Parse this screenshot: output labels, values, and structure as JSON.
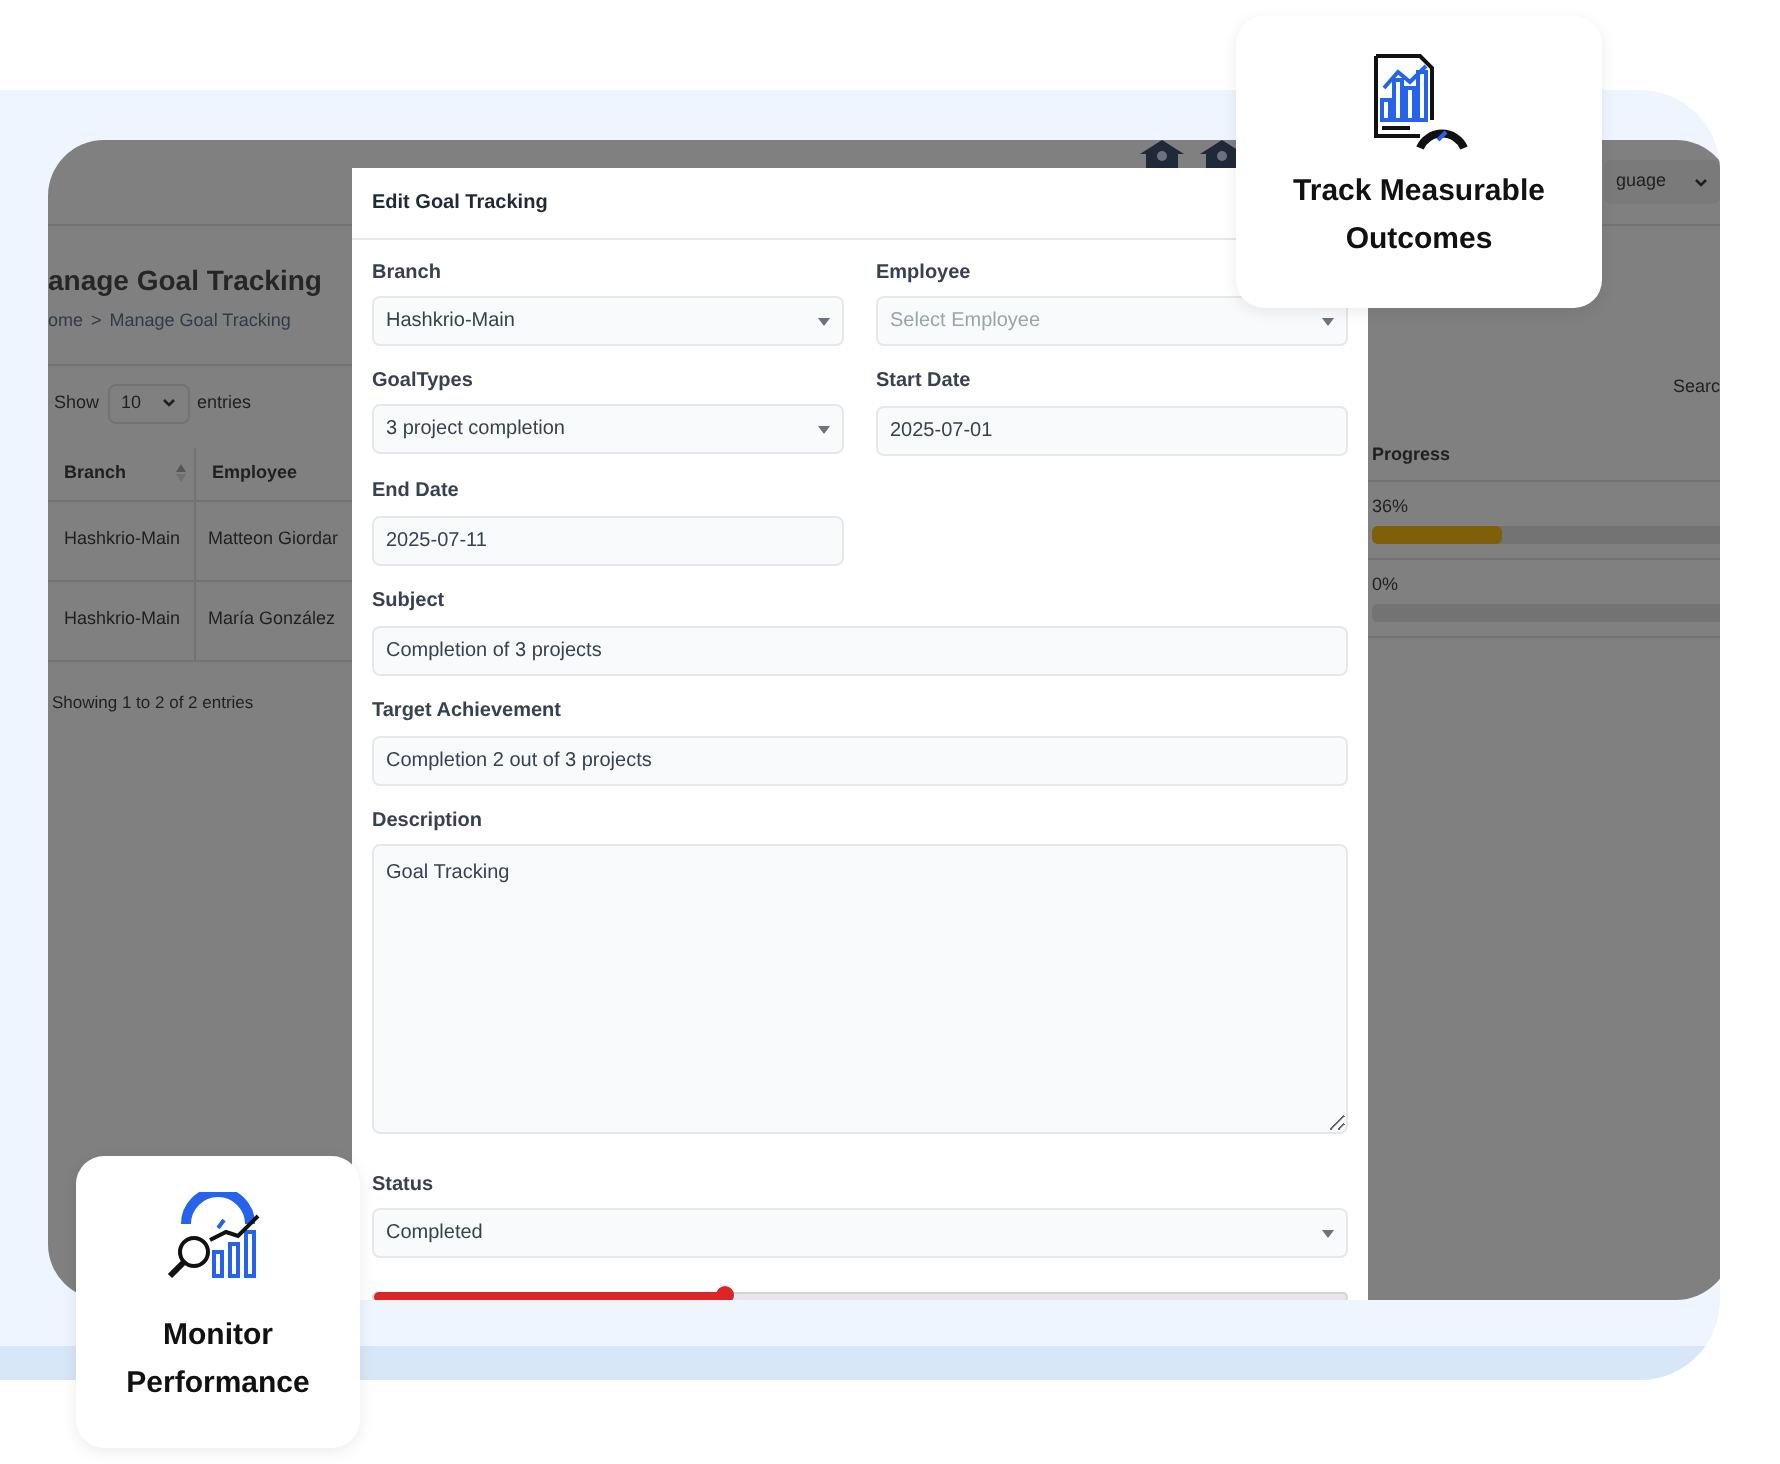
{
  "background_app": {
    "language_select": "guage",
    "page_title": "anage Goal Tracking",
    "breadcrumb": {
      "items": [
        "ome",
        "Manage Goal Tracking"
      ],
      "separator": ">"
    },
    "show_label": "Show",
    "entries_select": "10",
    "entries_label": "entries",
    "search_label": "Searc",
    "columns": [
      "Branch",
      "Employee",
      "Progress"
    ],
    "rows": [
      {
        "branch": "Hashkrio-Main",
        "employee": "Matteon Giordar",
        "progress": "36%",
        "level": 0.36
      },
      {
        "branch": "Hashkrio-Main",
        "employee": "María González",
        "progress": "0%"
      }
    ],
    "info": "Showing 1 to 2 of 2 entries"
  },
  "modal": {
    "title": "Edit Goal Tracking",
    "fields": [
      {
        "kind": "select",
        "label": "Branch",
        "value": "Hashkrio-Main"
      },
      {
        "kind": "select",
        "label": "Employee",
        "placeholder": "Select Employee"
      },
      {
        "kind": "select",
        "label": "GoalTypes",
        "value": "3 project completion"
      },
      {
        "kind": "input",
        "label": "Start Date",
        "value": "2025-07-01"
      },
      {
        "kind": "input",
        "label": "End Date",
        "value": "2025-07-11"
      },
      {
        "kind": "wide_input",
        "label": "Subject",
        "value": "Completion of 3 projects"
      },
      {
        "kind": "wide_input",
        "label": "Target Achievement",
        "value": "Completion 2 out of 3 projects"
      },
      {
        "kind": "textarea",
        "label": "Description",
        "value": "Goal Tracking"
      },
      {
        "kind": "wide_select",
        "label": "Status",
        "value": "Completed"
      },
      {
        "kind": "slider",
        "level": 0.36
      }
    ]
  },
  "callouts": [
    {
      "text": "Track Measurable Outcomes"
    },
    {
      "text": "Monitor Performance"
    }
  ]
}
